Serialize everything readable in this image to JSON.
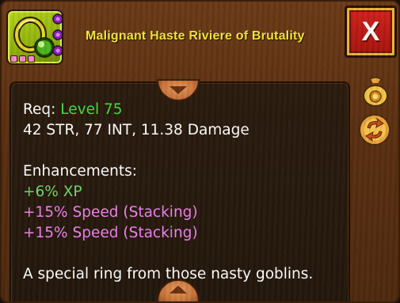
{
  "item": {
    "title": "Malignant Haste Riviere of Brutality",
    "icon": "ring-icon",
    "gem_sockets": [
      {
        "color": "#a02ac8"
      },
      {
        "color": "#a02ac8"
      },
      {
        "color": "#a02ac8"
      }
    ],
    "rune_slots": [
      {
        "color": "#f08ad0"
      },
      {
        "color": "#f08ad0"
      },
      {
        "color": "#f08ad0"
      }
    ]
  },
  "close_button": {
    "label": "X"
  },
  "side_icons": [
    "gold-bag-icon",
    "swap-arrows-icon"
  ],
  "details": {
    "req_label": "Req: ",
    "req_level": "Level 75",
    "stats": "42 STR, 77 INT, 11.38 Damage",
    "enh_header": "Enhancements:",
    "enhancements": [
      {
        "text": "+6% XP",
        "color": "green"
      },
      {
        "text": "+15% Speed (Stacking)",
        "color": "pink"
      },
      {
        "text": "+15% Speed (Stacking)",
        "color": "pink"
      }
    ],
    "description": "A special ring from those nasty goblins."
  },
  "colors": {
    "title": "#f5e63c",
    "req_level": "#3fde3f",
    "xp": "#6cd86c",
    "speed": "#ee82ee",
    "close_bg": "#c01a14"
  }
}
